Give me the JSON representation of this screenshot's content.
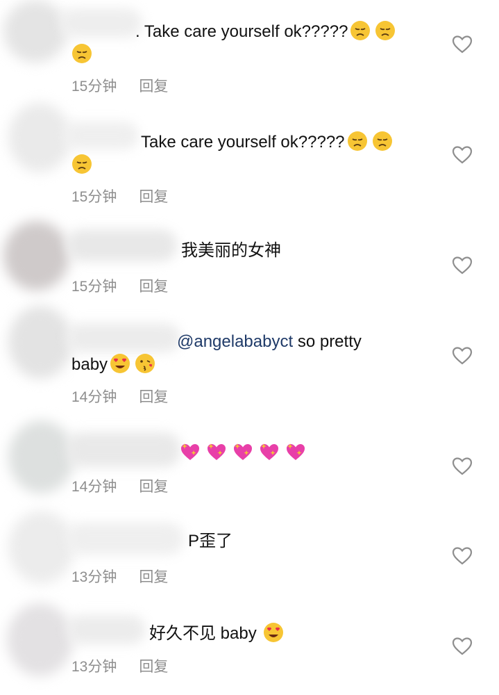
{
  "comments": [
    {
      "text_a": ". Take care yourself ok?????",
      "emoji_a": [
        "disappointed-face",
        "disappointed-face"
      ],
      "emoji_b": [
        "disappointed-face"
      ],
      "time": "15分钟",
      "reply": "回复"
    },
    {
      "text_a": "Take care yourself ok?????",
      "emoji_a": [
        "disappointed-face",
        "disappointed-face"
      ],
      "emoji_b": [
        "disappointed-face"
      ],
      "time": "15分钟",
      "reply": "回复"
    },
    {
      "text_a": "我美丽的女神",
      "time": "15分钟",
      "reply": "回复"
    },
    {
      "mention": "@angelababyct",
      "text_a": " so pretty",
      "text_b": "baby",
      "emoji_b": [
        "heart-eyes-face",
        "kiss-face"
      ],
      "time": "14分钟",
      "reply": "回复"
    },
    {
      "emoji_a": [
        "sparkling-heart",
        "sparkling-heart",
        "sparkling-heart",
        "sparkling-heart",
        "sparkling-heart"
      ],
      "time": "14分钟",
      "reply": "回复"
    },
    {
      "text_a": "P歪了",
      "time": "13分钟",
      "reply": "回复"
    },
    {
      "text_a": "好久不见 baby ",
      "emoji_a": [
        "heart-eyes-face"
      ],
      "time": "13分钟",
      "reply": "回复"
    }
  ],
  "colors": {
    "meta": "#8e8e8e",
    "mention": "#1f3a68",
    "emoji_yellow": "#f7c534",
    "sparkle_pink": "#e83fa8"
  },
  "icons": {
    "like": "heart-outline-icon"
  }
}
